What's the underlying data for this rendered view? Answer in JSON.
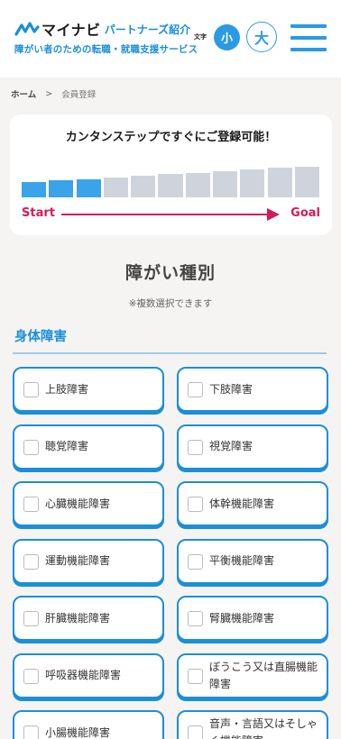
{
  "header": {
    "brand": "マイナビ",
    "brand_sub": "パートナーズ紹介",
    "tagline": "障がい者のための転職・就職支援サービス",
    "font_size_label": "文字",
    "font_small": "小",
    "font_large": "大"
  },
  "breadcrumb": {
    "home": "ホーム",
    "separator": ">",
    "current": "会員登録"
  },
  "steps": {
    "title": "カンタンステップですぐにご登録可能！",
    "total": 11,
    "completed": 3,
    "start_label": "Start",
    "goal_label": "Goal",
    "active_color": "#3aa3ea",
    "inactive_color": "#cfd4dc"
  },
  "section": {
    "title": "障がい種別",
    "note": "※複数選択できます"
  },
  "category": {
    "title": "身体障害",
    "options": [
      "上肢障害",
      "下肢障害",
      "聴覚障害",
      "視覚障害",
      "心臓機能障害",
      "体幹機能障害",
      "運動機能障害",
      "平衡機能障害",
      "肝臓機能障害",
      "腎臓機能障害",
      "呼吸器機能障害",
      "ぼうこう又は直腸機能障害",
      "小腸機能障害",
      "音声・言語又はそしゃく機能障害"
    ]
  },
  "colors": {
    "accent": "#1b8fd8",
    "progress_arrow": "#d6195c"
  }
}
